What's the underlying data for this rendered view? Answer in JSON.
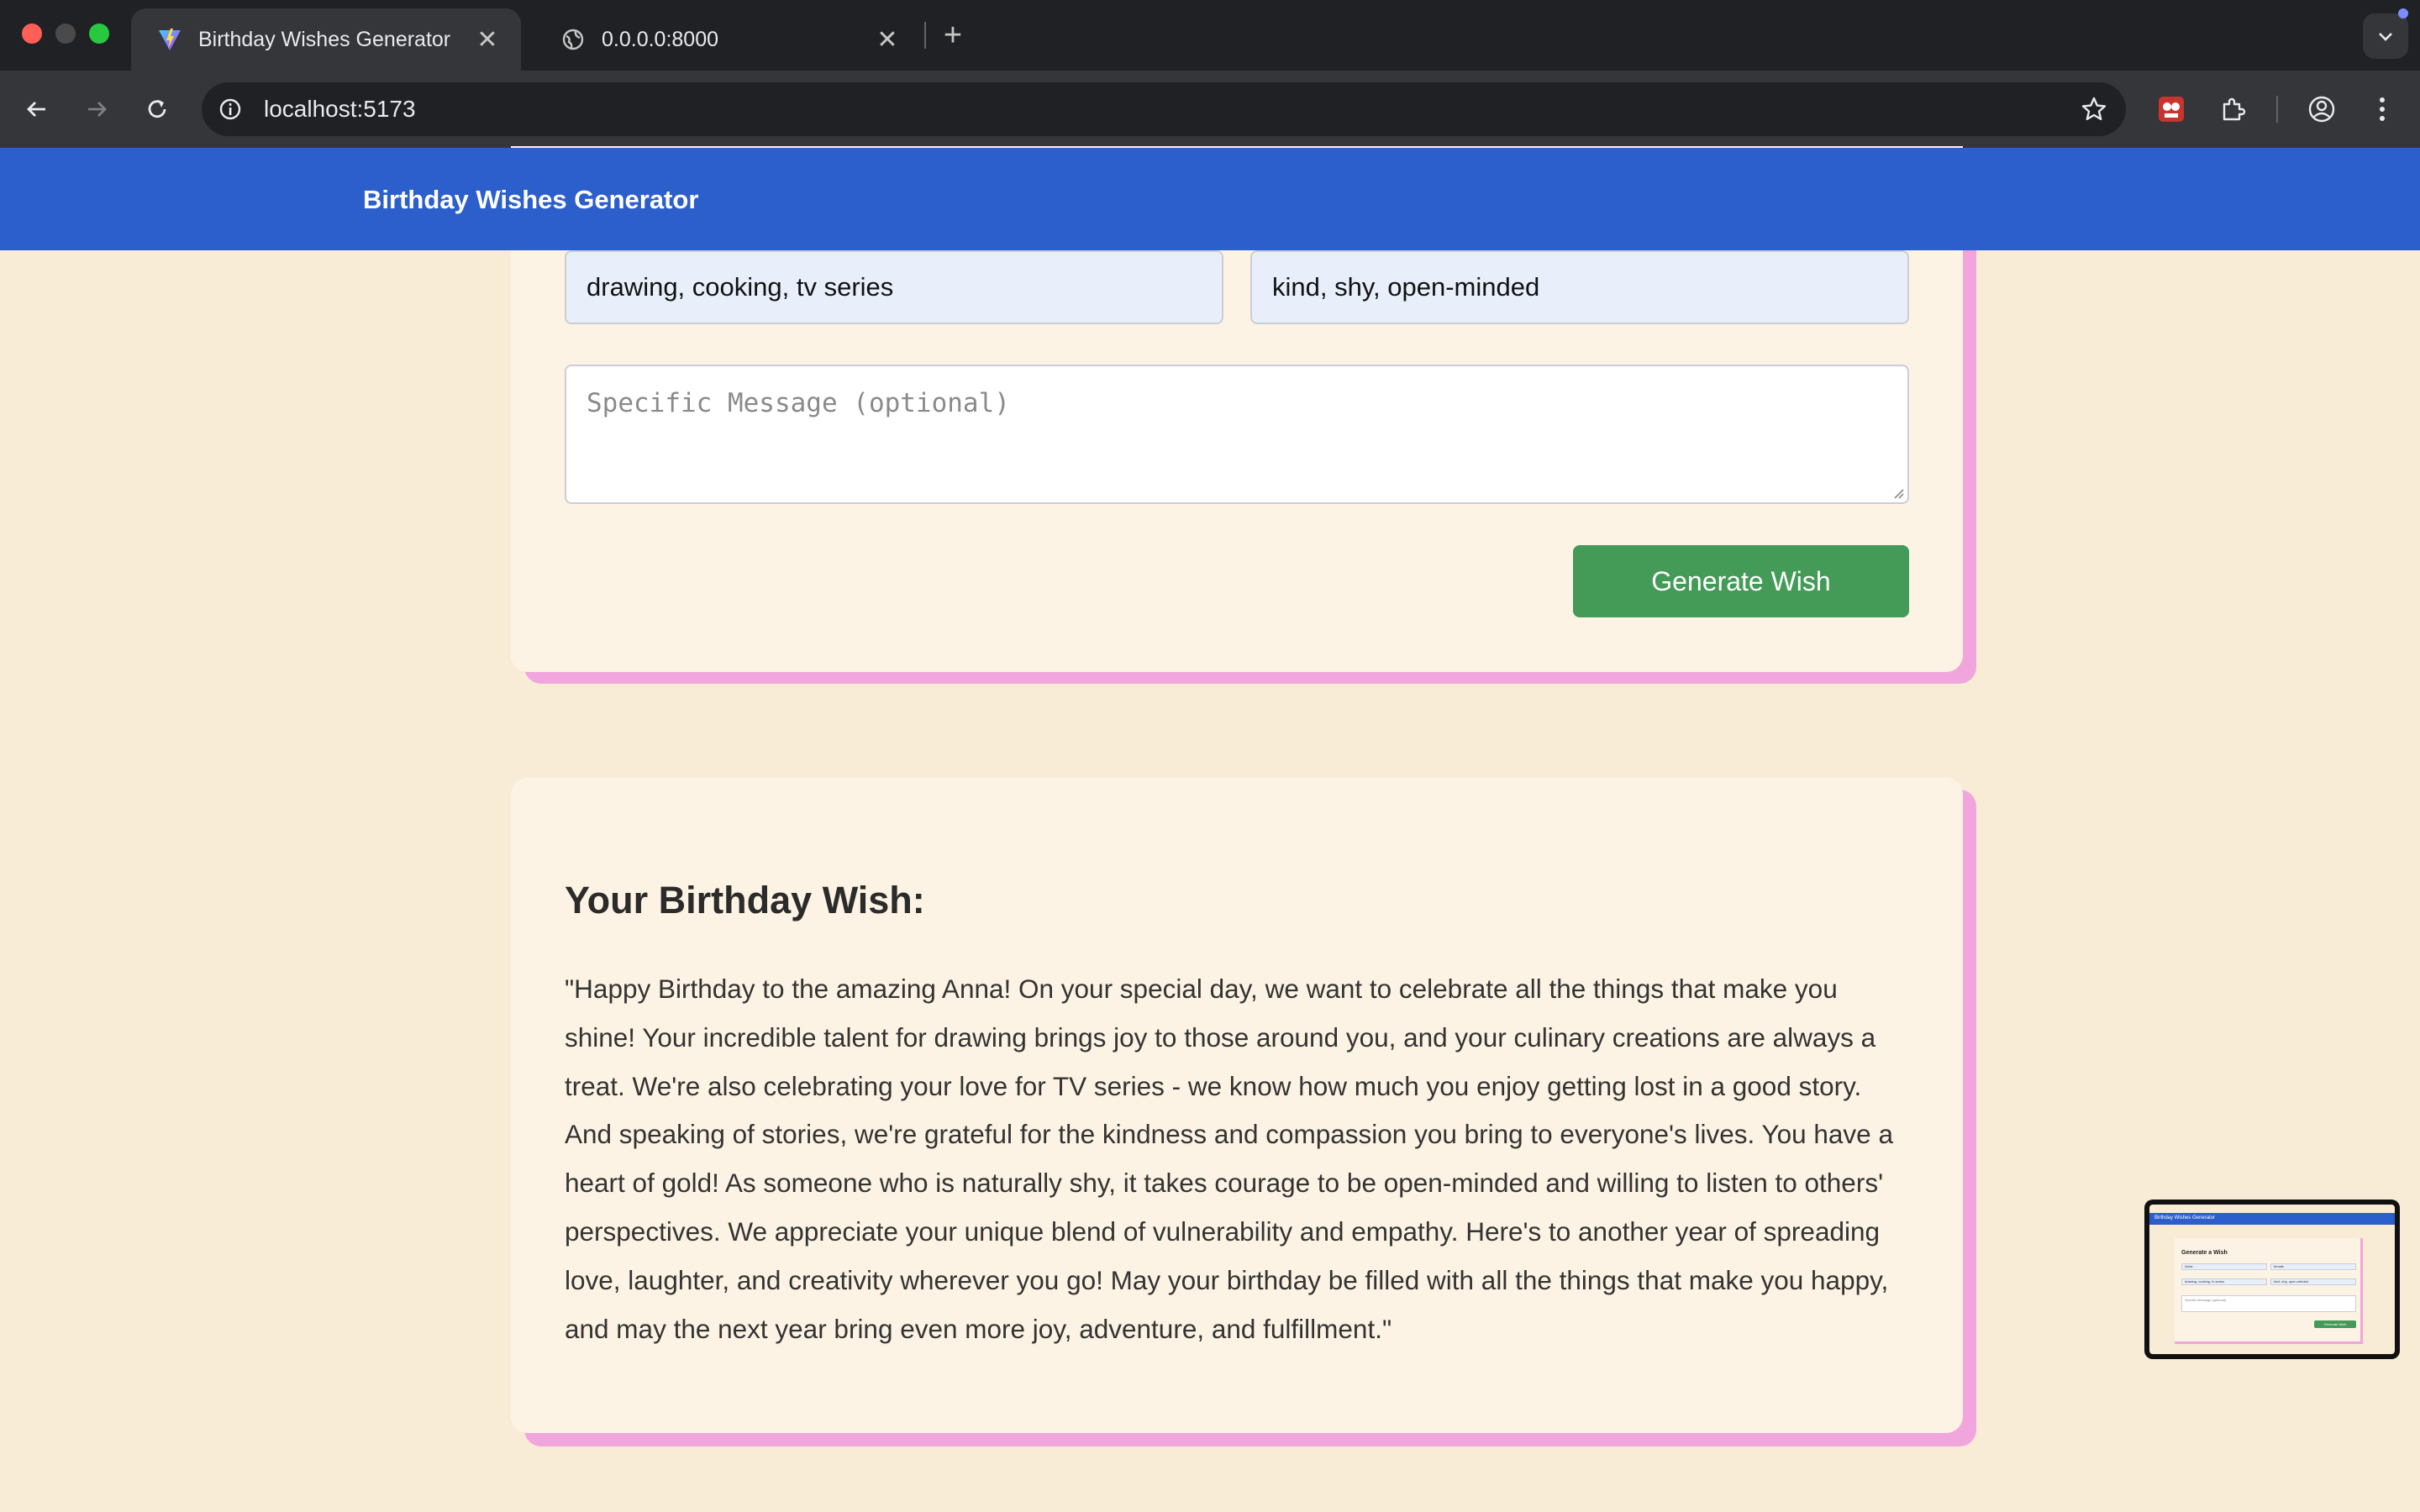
{
  "browser": {
    "tabs": [
      {
        "title": "Birthday Wishes Generator",
        "active": true
      },
      {
        "title": "0.0.0.0:8000",
        "active": false
      }
    ],
    "url": "localhost:5173"
  },
  "app": {
    "title": "Birthday Wishes Generator",
    "accent_color": "#2c5fcc",
    "button_color": "#439b57",
    "card_border_color": "#f0a6dc"
  },
  "form": {
    "hobbies_value": "drawing, cooking, tv series",
    "traits_value": "kind, shy, open-minded",
    "message_placeholder": "Specific Message (optional)",
    "generate_label": "Generate Wish"
  },
  "result": {
    "heading": "Your Birthday Wish:",
    "text": "\"Happy Birthday to the amazing Anna! On your special day, we want to celebrate all the things that make you shine! Your incredible talent for drawing brings joy to those around you, and your culinary creations are always a treat. We're also celebrating your love for TV series - we know how much you enjoy getting lost in a good story. And speaking of stories, we're grateful for the kindness and compassion you bring to everyone's lives. You have a heart of gold! As someone who is naturally shy, it takes courage to be open-minded and willing to listen to others' perspectives. We appreciate your unique blend of vulnerability and empathy. Here's to another year of spreading love, laughter, and creativity wherever you go! May your birthday be filled with all the things that make you happy, and may the next year bring even more joy, adventure, and fulfillment.\""
  },
  "preview": {
    "header": "Birthday Wishes Generator",
    "title": "Generate a Wish",
    "fields": [
      "Anna",
      "female",
      "drawing, cooking, tv series",
      "kind, shy, open-minded"
    ],
    "message_placeholder": "Specific Message (optional)",
    "button": "Generate Wish"
  }
}
